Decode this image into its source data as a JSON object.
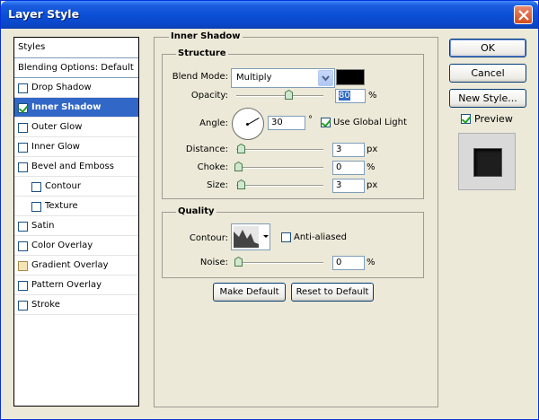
{
  "window": {
    "title": "Layer Style"
  },
  "styles": {
    "header": "Styles",
    "blending": "Blending Options: Default",
    "items": [
      {
        "label": "Drop Shadow",
        "checked": false,
        "sub": false
      },
      {
        "label": "Inner Shadow",
        "checked": true,
        "sub": false,
        "selected": true
      },
      {
        "label": "Outer Glow",
        "checked": false,
        "sub": false
      },
      {
        "label": "Inner Glow",
        "checked": false,
        "sub": false
      },
      {
        "label": "Bevel and Emboss",
        "checked": false,
        "sub": false
      },
      {
        "label": "Contour",
        "checked": false,
        "sub": true
      },
      {
        "label": "Texture",
        "checked": false,
        "sub": true
      },
      {
        "label": "Satin",
        "checked": false,
        "sub": false
      },
      {
        "label": "Color Overlay",
        "checked": false,
        "sub": false
      },
      {
        "label": "Gradient Overlay",
        "checked": false,
        "sub": false
      },
      {
        "label": "Pattern Overlay",
        "checked": false,
        "sub": false
      },
      {
        "label": "Stroke",
        "checked": false,
        "sub": false
      }
    ]
  },
  "inner_shadow": {
    "title": "Inner Shadow",
    "structure": {
      "title": "Structure",
      "blend_mode_label": "Blend Mode:",
      "blend_mode": "Multiply",
      "color": "#000000",
      "opacity_label": "Opacity:",
      "opacity": "80",
      "opacity_unit": "%",
      "angle_label": "Angle:",
      "angle": "30",
      "angle_unit": "°",
      "use_global_light": "Use Global Light",
      "distance_label": "Distance:",
      "distance": "3",
      "distance_unit": "px",
      "choke_label": "Choke:",
      "choke": "0",
      "choke_unit": "%",
      "size_label": "Size:",
      "size": "3",
      "size_unit": "px"
    },
    "quality": {
      "title": "Quality",
      "contour_label": "Contour:",
      "anti_aliased": "Anti-aliased",
      "noise_label": "Noise:",
      "noise": "0",
      "noise_unit": "%"
    },
    "make_default": "Make Default",
    "reset_default": "Reset to Default"
  },
  "buttons": {
    "ok": "OK",
    "cancel": "Cancel",
    "new_style": "New Style...",
    "preview": "Preview"
  }
}
